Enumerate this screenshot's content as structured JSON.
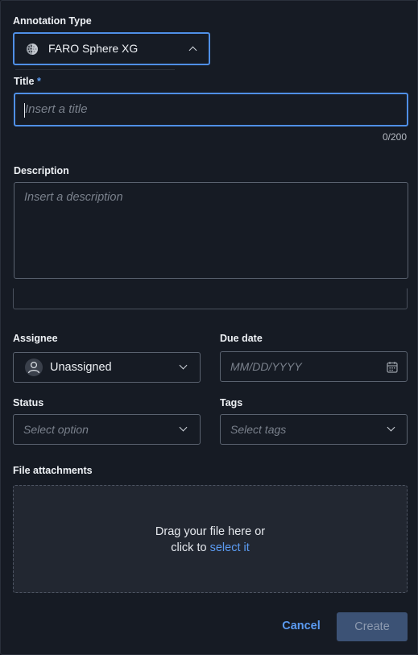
{
  "annotation_type": {
    "label": "Annotation Type",
    "selected": "FARO Sphere XG",
    "icon": "sphere-icon"
  },
  "title_field": {
    "label": "Title",
    "required_mark": "*",
    "placeholder": "Insert a title",
    "value": "",
    "counter": "0/200"
  },
  "description_field": {
    "label": "Description",
    "placeholder": "Insert a description"
  },
  "assignee": {
    "label": "Assignee",
    "value": "Unassigned",
    "icon": "user-avatar-icon"
  },
  "due_date": {
    "label": "Due date",
    "placeholder": "MM/DD/YYYY",
    "icon": "calendar-icon"
  },
  "status": {
    "label": "Status",
    "placeholder": "Select option"
  },
  "tags": {
    "label": "Tags",
    "placeholder": "Select tags"
  },
  "attachments": {
    "label": "File attachments",
    "line1": "Drag your file here or",
    "line2_prefix": "click to",
    "link": "select it"
  },
  "actions": {
    "cancel": "Cancel",
    "create": "Create"
  },
  "colors": {
    "accent": "#5b9bf2",
    "background": "#161b24",
    "create_disabled": "#3c5275"
  }
}
